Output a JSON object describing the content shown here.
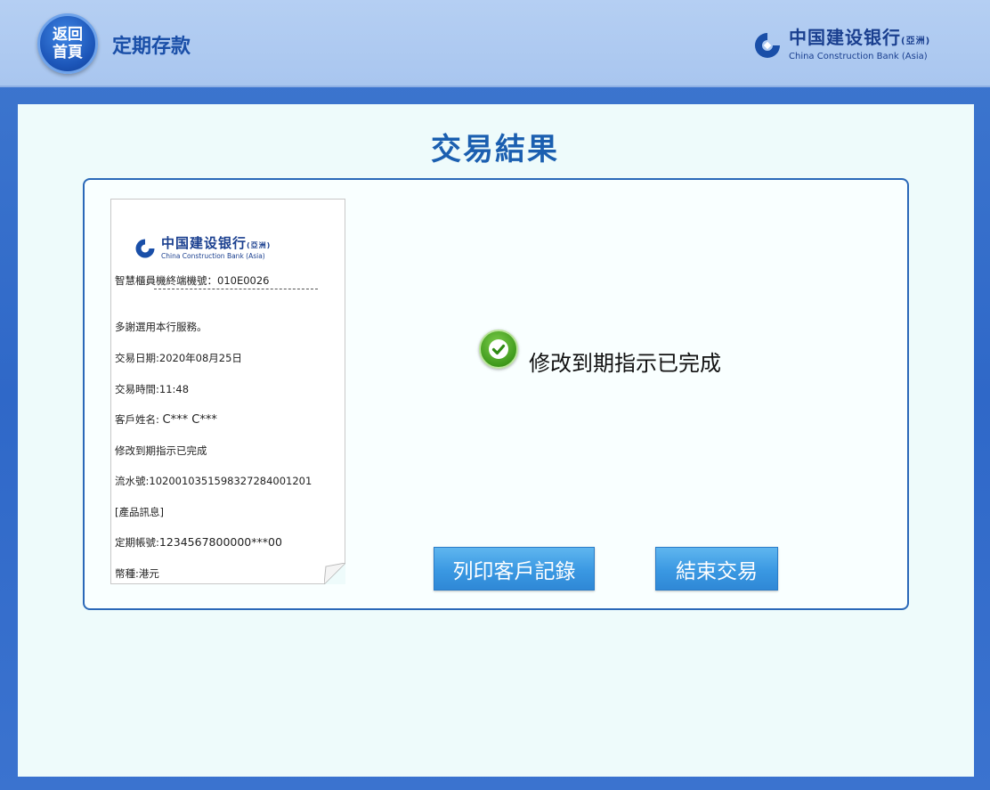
{
  "header": {
    "home_label": "返回首頁",
    "title": "定期存款",
    "logo_cn": "中国建设银行",
    "logo_cn_suffix": "(亞洲)",
    "logo_en": "China Construction Bank (Asia)"
  },
  "page": {
    "title": "交易結果"
  },
  "receipt": {
    "logo_cn": "中国建设银行",
    "logo_cn_suffix": "(亞洲)",
    "logo_en": "China Construction Bank (Asia)",
    "terminal": "智慧櫃員機終端機號：010E0026",
    "thanks": "多謝選用本行服務。",
    "date": "交易日期:2020年08月25日",
    "time": "交易時間:11:48",
    "customer_label": "客戶姓名:",
    "customer_name": "C*** C***",
    "result": "修改到期指示已完成",
    "serial": "流水號:1020010351598327284001201",
    "product_info": "[產品訊息]",
    "account_label": "定期帳號:",
    "account_no": "1234567800000***00",
    "currency": "幣種:港元"
  },
  "status": {
    "icon": "check-circle-icon",
    "message": "修改到期指示已完成",
    "color": "#3f9a1c"
  },
  "buttons": {
    "print_label": "列印客戶記錄",
    "end_label": "結束交易"
  },
  "colors": {
    "brand": "#1a3f8f",
    "accent": "#1b5fb0",
    "button": "#3a98e2"
  }
}
